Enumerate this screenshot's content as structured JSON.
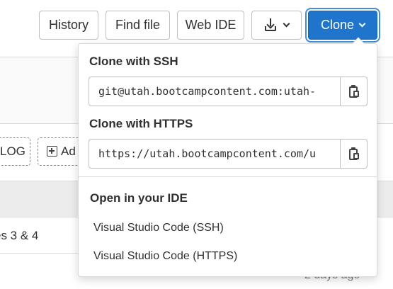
{
  "toolbar": {
    "history_label": "History",
    "find_file_label": "Find file",
    "web_ide_label": "Web IDE",
    "clone_label": "Clone"
  },
  "background": {
    "changelog_label": "LOG",
    "add_label": "Ad",
    "row_text": "es 3 & 4",
    "timestamp": "2 days ago"
  },
  "clone_dropdown": {
    "ssh_label": "Clone with SSH",
    "ssh_url": "git@utah.bootcampcontent.com:utah-",
    "https_label": "Clone with HTTPS",
    "https_url": "https://utah.bootcampcontent.com/u",
    "ide_label": "Open in your IDE",
    "ide_options": [
      "Visual Studio Code (SSH)",
      "Visual Studio Code (HTTPS)"
    ]
  },
  "icons": {
    "download": "download-icon",
    "chevron": "chevron-down-icon",
    "copy": "clipboard-icon"
  },
  "colors": {
    "clone_button_bg": "#1f75cb",
    "clone_focus_ring": "#428fdc"
  }
}
